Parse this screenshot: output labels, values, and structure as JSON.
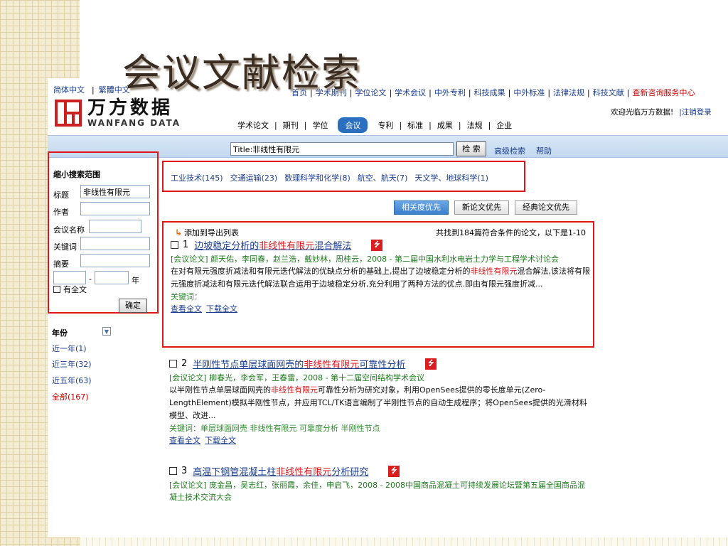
{
  "slide_title": "会议文献检索",
  "lang": {
    "simplified": "简体中文",
    "traditional": "繁體中文"
  },
  "logo": {
    "cn": "万方数据",
    "en": "WANFANG DATA"
  },
  "topnav": [
    "首页",
    "学术期刊",
    "学位论文",
    "学术会议",
    "中外专利",
    "科技成果",
    "中外标准",
    "法律法规",
    "科技文献",
    "查新咨询服务中心"
  ],
  "welcome": {
    "text": "欢迎光临万方数据!",
    "logout": "|注销登录"
  },
  "cattabs": [
    "学术论文",
    "期刊",
    "学位",
    "会议",
    "专利",
    "标准",
    "成果",
    "法规",
    "企业"
  ],
  "search": {
    "query": "Title:非线性有限元",
    "button": "检 索",
    "advanced": "高级检索",
    "help": "帮助"
  },
  "refine": {
    "title": "缩小搜索范围",
    "fields": [
      {
        "label": "标题",
        "value": "非线性有限元"
      },
      {
        "label": "作者",
        "value": ""
      },
      {
        "label": "会议名称",
        "value": ""
      },
      {
        "label": "关键词",
        "value": ""
      },
      {
        "label": "摘要",
        "value": ""
      }
    ],
    "range_sep": "-",
    "year_unit": "年",
    "fulltext": "有全文",
    "ok": "确定"
  },
  "years": {
    "title": "年份",
    "items": [
      "近一年(1)",
      "近三年(32)",
      "近五年(63)",
      "全部(167)"
    ]
  },
  "categories": [
    "工业技术(145)",
    "交通运输(23)",
    "数理科学和化学(8)",
    "航空、航天(7)",
    "天文学、地球科学(1)"
  ],
  "sort": [
    "相关度优先",
    "新论文优先",
    "经典论文优先"
  ],
  "export": "添加到导出列表",
  "found": "共找到184篇符合条件的论文，以下是1-10",
  "results": [
    {
      "num": "1",
      "title_pre": "边坡稳定分析的",
      "title_hl": "非线性有限元",
      "title_post": "混合解法",
      "meta": "[会议论文] 颜天佑，李同春，赵兰浩，戴妙林，周桂云，2008 - 第二届中国水利水电岩土力学与工程学术讨论会",
      "abs_pre": "在对有限元强度折减法和有限元迭代解法的优缺点分析的基础上,提出了边坡稳定分析的",
      "abs_hl": "非线性有限元",
      "abs_post": "混合解法,该法将有限元强度折减法和有限元迭代解法联合运用于边坡稳定分析,充分利用了两种方法的优点.即由有限元强度折减...",
      "kw": "关键词：",
      "view": "查看全文",
      "download": "下载全文"
    },
    {
      "num": "2",
      "title_pre": "半刚性节点单层球面网壳的",
      "title_hl": "非线性有限元",
      "title_post": "可靠性分析",
      "meta": "[会议论文] 柳春光，李会军，王春雷，2008 - 第十二届空间结构学术会议",
      "abs_pre": "以半刚性节点单层球面网壳的",
      "abs_hl": "非线性有限元",
      "abs_post": "可靠性分析为研究对象，利用OpenSees提供的零长度单元(Zero-LengthElement)模拟半刚性节点，并应用TCL/TK语言编制了半刚性节点的自动生成程序；将OpenSees提供的光滑材料模型、改进...",
      "kw": "关键词：单层球面网壳 非线性有限元 可靠度分析 半刚性节点",
      "view": "查看全文",
      "download": "下载全文"
    },
    {
      "num": "3",
      "title_pre": "高温下钢管混凝土柱",
      "title_hl": "非线性有限元",
      "title_post": "分析研究",
      "meta": "[会议论文] 庞金昌，吴志红，张丽霞，余佳，申启飞，2008 - 2008中国商品混凝土可持续发展论坛暨第五届全国商品混凝土技术交流大会"
    }
  ],
  "colors": {
    "accent_red": "#e0161b",
    "link_blue": "#1a3d8f",
    "meta_green": "#1f7a1f",
    "active_tab": "#2b6fc0"
  },
  "icons": [
    "pdf-icon",
    "export-arrow-icon",
    "checkbox-icon",
    "collapse-toggle-icon"
  ]
}
